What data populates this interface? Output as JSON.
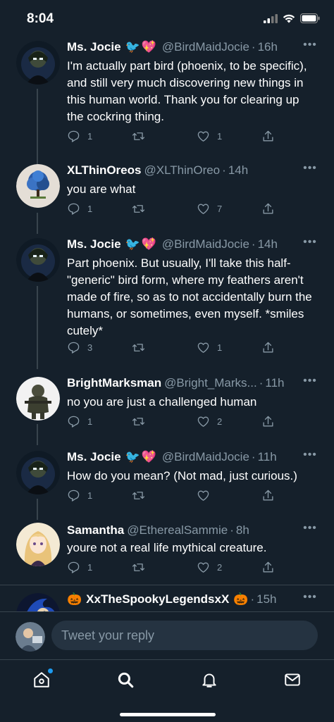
{
  "status_bar": {
    "time": "8:04"
  },
  "tweets": [
    {
      "name": "Ms. Jocie",
      "emoji": [
        "🐦",
        "💖"
      ],
      "handle": "@BirdMaidJocie",
      "time": "16h",
      "text": "I'm actually part bird (phoenix, to be specific), and still very much discovering new things in this human world. Thank you for clearing up the cockring thing.",
      "replies": "1",
      "retweets": "",
      "likes": "1"
    },
    {
      "name": "XLThinOreos",
      "emoji": [],
      "handle": "@XLThinOreo",
      "time": "14h",
      "text": "you are what",
      "replies": "1",
      "retweets": "",
      "likes": "7"
    },
    {
      "name": "Ms. Jocie",
      "emoji": [
        "🐦",
        "💖"
      ],
      "handle": "@BirdMaidJocie",
      "time": "14h",
      "text": "Part phoenix. But usually, I'll take this half-\"generic\" bird form, where my feathers aren't made of fire, so as to not accidentally burn the humans, or sometimes, even myself. *smiles cutely*",
      "replies": "3",
      "retweets": "",
      "likes": "1"
    },
    {
      "name": "BrightMarksman",
      "emoji": [],
      "handle": "@Bright_Marks...",
      "time": "11h",
      "text": "no you are just a challenged human",
      "replies": "1",
      "retweets": "",
      "likes": "2"
    },
    {
      "name": "Ms. Jocie",
      "emoji": [
        "🐦",
        "💖"
      ],
      "handle": "@BirdMaidJocie",
      "time": "11h",
      "text": "How do you mean? (Not mad, just curious.)",
      "replies": "1",
      "retweets": "",
      "likes": ""
    },
    {
      "name": "Samantha",
      "emoji": [],
      "handle": "@EtherealSammie",
      "time": "8h",
      "text": "youre not a real life mythical creature.",
      "replies": "1",
      "retweets": "",
      "likes": "2"
    },
    {
      "name": "XxTheSpookyLegendsxX",
      "emoji_before": "🎃",
      "emoji_after": "🎃",
      "handle": "",
      "time": "15h"
    }
  ],
  "reply_bar": {
    "placeholder": "Tweet your reply"
  },
  "icons": {
    "more": "more-dots-icon",
    "reply": "reply-icon",
    "retweet": "retweet-icon",
    "like": "heart-icon",
    "share": "share-icon",
    "home": "home-icon",
    "search": "search-icon",
    "notifications": "bell-icon",
    "messages": "mail-icon"
  },
  "colors": {
    "background": "#15202b",
    "secondary_text": "#8899a6",
    "divider": "#38444d",
    "accent": "#1d9bf0"
  }
}
